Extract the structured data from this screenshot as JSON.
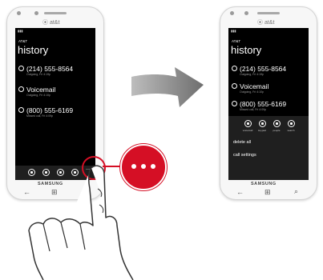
{
  "carrier_logo": "⦿ at&t",
  "status_carrier": "AT&T",
  "left_screen": {
    "app_title": "AT&T",
    "pivot_title": "history",
    "entries": [
      {
        "name": "(214) 555-8564",
        "detail": "Outgoing, Fri 4:19p"
      },
      {
        "name": "Voicemail",
        "detail": "Outgoing, Fri 4:10p"
      },
      {
        "name": "(800) 555-6169",
        "detail": "Missed call, Fri 4:09p"
      }
    ],
    "more_label": "..."
  },
  "right_screen": {
    "app_title": "AT&T",
    "pivot_title": "history",
    "entries": [
      {
        "name": "(214) 555-8564",
        "detail": "Outgoing, Fri 4:19p"
      },
      {
        "name": "Voicemail",
        "detail": "Outgoing, Fri 4:10p"
      },
      {
        "name": "(800) 555-6169",
        "detail": "Missed call, Fri 4:09p"
      }
    ],
    "appbar_labels": [
      "voicemail",
      "keypad",
      "people",
      "search"
    ],
    "menu": [
      "delete all",
      "call settings"
    ]
  },
  "brand": "SAMSUNG",
  "colors": {
    "callout_red": "#d50f25",
    "screen_bg": "#000000",
    "arrow_gray": "#8a8a8a"
  },
  "icons": [
    "back-arrow-icon",
    "windows-start-icon",
    "search-icon",
    "phone-icon",
    "more-dots-icon",
    "arrow-right-icon",
    "hand-pointer-icon"
  ]
}
